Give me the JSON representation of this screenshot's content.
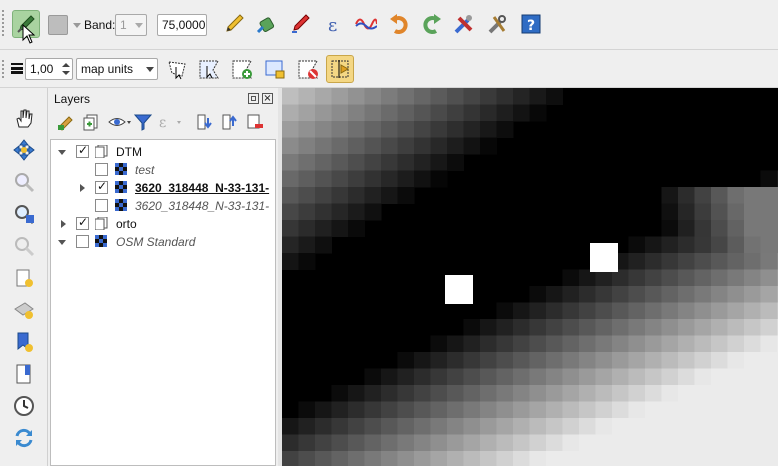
{
  "toolbar": {
    "band_label": "Band:",
    "band_value": "1",
    "value_field": "75,0000"
  },
  "toolbar2": {
    "width_value": "1,00",
    "units_value": "map units"
  },
  "layers_panel": {
    "title": "Layers",
    "tree": [
      {
        "label": "DTM",
        "style": "normal"
      },
      {
        "label": "test",
        "style": "italic"
      },
      {
        "label": "3620_318448_N-33-131-",
        "style": "bold"
      },
      {
        "label": "3620_318448_N-33-131-",
        "style": "italic"
      },
      {
        "label": "orto",
        "style": "normal"
      },
      {
        "label": "OSM Standard",
        "style": "italic"
      }
    ]
  },
  "colors": {
    "active_tool_bg": "#a9d3a0",
    "selected_tool_bg": "#f4d784"
  }
}
